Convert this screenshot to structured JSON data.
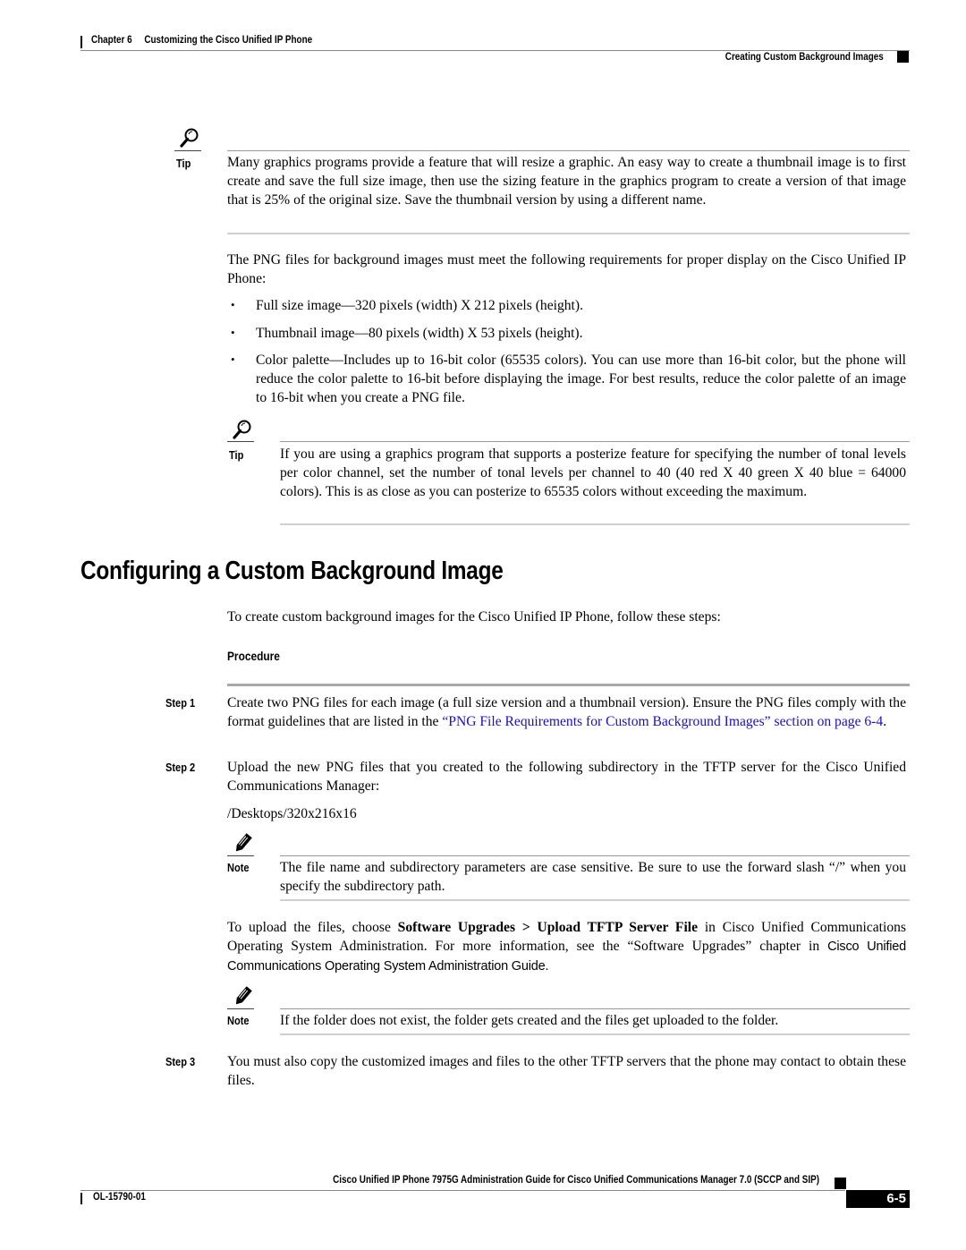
{
  "header": {
    "chapter": "Chapter 6",
    "chapter_title": "Customizing the Cisco Unified IP Phone",
    "section": "Creating Custom Background Images"
  },
  "tip1": {
    "icon": "magnifier-icon",
    "label": "Tip",
    "text": "Many graphics programs provide a feature that will resize a graphic. An easy way to create a thumbnail image is to first create and save the full size image, then use the sizing feature in the graphics program to create a version of that image that is 25% of the original size. Save the thumbnail version by using a different name."
  },
  "requirements": {
    "intro": "The PNG files for background images must meet the following requirements for proper display on the Cisco Unified IP Phone:",
    "bullets": [
      "Full size image—320 pixels (width) X 212 pixels (height).",
      "Thumbnail image—80 pixels (width) X 53 pixels (height).",
      "Color palette—Includes up to 16-bit color (65535 colors). You can use more than 16-bit color, but the phone will reduce the color palette to 16-bit before displaying the image. For best results, reduce the color palette of an image to 16-bit when you create a PNG file."
    ]
  },
  "tip2": {
    "icon": "magnifier-icon",
    "label": "Tip",
    "text": "If you are using a graphics program that supports a posterize feature for specifying the number of tonal levels per color channel, set the number of tonal levels per channel to 40 (40 red X 40 green X 40 blue = 64000 colors). This is as close as you can posterize to 65535 colors without exceeding the maximum."
  },
  "section": {
    "title": "Configuring a Custom Background Image",
    "intro": "To create custom background images for the Cisco Unified IP Phone, follow these steps:",
    "procedure_label": "Procedure"
  },
  "steps": [
    {
      "label": "Step 1",
      "text_before": "Create two PNG files for each image (a full size version and a thumbnail version). Ensure the PNG files comply with the format guidelines that are listed in the ",
      "link": "“PNG File Requirements for Custom Background Images” section on page 6-4",
      "text_after": "."
    },
    {
      "label": "Step 2",
      "text": "Upload the new PNG files that you created to the following subdirectory in the TFTP server for the Cisco Unified Communications Manager:",
      "path": "/Desktops/320x216x16",
      "note1": {
        "icon": "pencil-icon",
        "label": "Note",
        "text": "The file name and subdirectory parameters are case sensitive. Be sure to use the forward slash “/” when you specify the subdirectory path."
      },
      "upload_before": "To upload the files, choose ",
      "upload_menu": "Software Upgrades > Upload TFTP Server File",
      "upload_mid": " in Cisco Unified Communications Operating System Administration. For more information, see the “Software Upgrades” chapter in ",
      "upload_guide": "Cisco Unified Communications Operating System Administration Guide.",
      "note2": {
        "icon": "pencil-icon",
        "label": "Note",
        "text": "If the folder does not exist, the folder gets created and the files get uploaded to the folder."
      }
    },
    {
      "label": "Step 3",
      "text": "You must also copy the customized images and files to the other TFTP servers that the phone may contact to obtain these files."
    }
  ],
  "footer": {
    "title": "Cisco Unified IP Phone 7975G Administration Guide for Cisco Unified Communications Manager 7.0 (SCCP and SIP)",
    "doc_number": "OL-15790-01",
    "page_number": "6-5"
  }
}
